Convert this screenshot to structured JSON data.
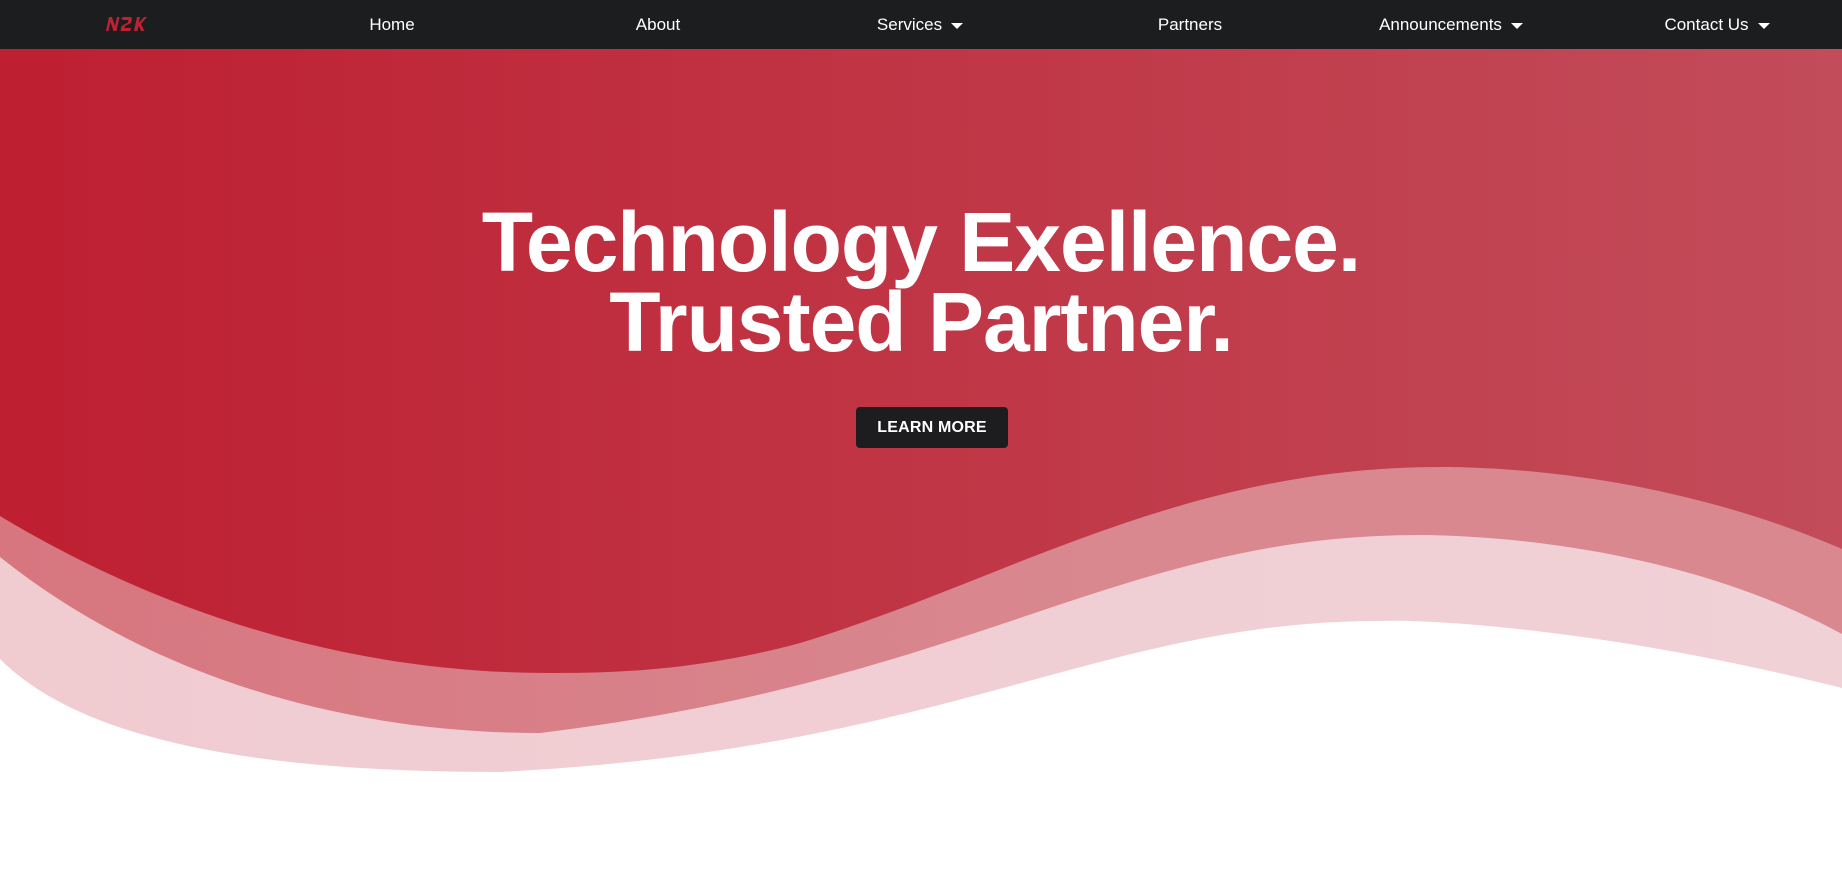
{
  "nav": {
    "logo_text": "N2K",
    "items": [
      {
        "label": "Home",
        "has_dropdown": false
      },
      {
        "label": "About",
        "has_dropdown": false
      },
      {
        "label": "Services",
        "has_dropdown": true
      },
      {
        "label": "Partners",
        "has_dropdown": false
      },
      {
        "label": "Announcements",
        "has_dropdown": true
      },
      {
        "label": "Contact Us",
        "has_dropdown": true
      }
    ]
  },
  "hero": {
    "headline_line1": "Technology Exellence.",
    "headline_line2": "Trusted Partner.",
    "cta_label": "LEARN MORE"
  },
  "colors": {
    "nav_bg": "#1c1d1f",
    "brand_red": "#c02032",
    "hero_right": "#c24c5a",
    "wave_mid": "#d9848d",
    "wave_light": "#f0d0d5",
    "button_bg": "#1d1d1f"
  },
  "icons": {
    "logo": "n2k-logo",
    "dropdown": "caret-down-icon"
  }
}
